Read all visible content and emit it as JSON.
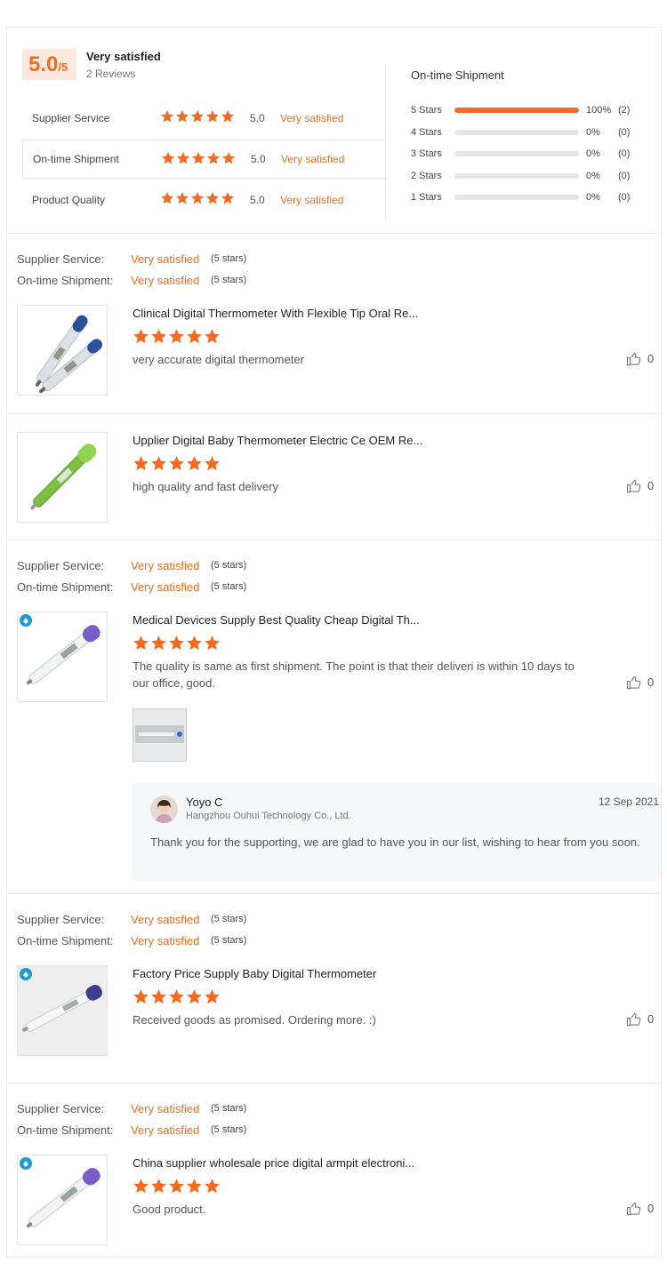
{
  "summary": {
    "score": "5.0",
    "score_unit": "/5",
    "overall_label": "Very satisfied",
    "review_count": "2 Reviews",
    "metrics": [
      {
        "name": "Supplier Service",
        "score": "5.0",
        "text": "Very satisfied"
      },
      {
        "name": "On-time Shipment",
        "score": "5.0",
        "text": "Very satisfied"
      },
      {
        "name": "Product Quality",
        "score": "5.0",
        "text": "Very satisfied"
      }
    ],
    "active_metric_index": 1,
    "distribution_title": "On-time Shipment",
    "distribution": [
      {
        "label": "5 Stars",
        "fraction": 1.0,
        "pct": "100%",
        "count": "(2)"
      },
      {
        "label": "4 Stars",
        "fraction": 0,
        "pct": "0%",
        "count": "(0)"
      },
      {
        "label": "3 Stars",
        "fraction": 0,
        "pct": "0%",
        "count": "(0)"
      },
      {
        "label": "2 Stars",
        "fraction": 0,
        "pct": "0%",
        "count": "(0)"
      },
      {
        "label": "1 Stars",
        "fraction": 0,
        "pct": "0%",
        "count": "(0)"
      }
    ]
  },
  "labels": {
    "supplier_service": "Supplier Service:",
    "ontime_shipment": "On-time Shipment:",
    "very_satisfied": "Very satisfied",
    "five_stars": "(5 stars)"
  },
  "reviews": [
    {
      "products": [
        {
          "title": "Clinical Digital Thermometer With Flexible Tip Oral Re...",
          "stars": 5,
          "text": "very accurate digital thermometer",
          "likes": "0",
          "image": "two-blue-thermometers"
        },
        {
          "title": "Upplier Digital Baby Thermometer Electric Ce OEM Re...",
          "stars": 5,
          "text": "high quality and fast delivery",
          "likes": "0",
          "image": "green-thermometer"
        }
      ]
    },
    {
      "products": [
        {
          "title": "Medical Devices Supply Best Quality Cheap Digital Th...",
          "stars": 5,
          "text": "The quality is same as first shipment. The point is that their deliveri is within 10 days to our office,  good.",
          "likes": "0",
          "image": "purple-thermometer"
        }
      ],
      "reply": {
        "name": "Yoyo C",
        "company": "Hangzhou Ouhui Technology Co., Ltd.",
        "date": "12 Sep 2021",
        "text": "Thank you for the supporting, we are glad to have you in our list, wishing to hear from you soon."
      }
    },
    {
      "products": [
        {
          "title": "Factory Price Supply Baby Digital Thermometer",
          "stars": 5,
          "text": "Received goods as promised. Ordering more. :)",
          "likes": "0",
          "image": "navy-thermometer"
        }
      ]
    },
    {
      "products": [
        {
          "title": "China supplier wholesale price digital armpit electroni...",
          "stars": 5,
          "text": "Good product.",
          "likes": "0",
          "image": "purple-thermometer"
        }
      ]
    }
  ],
  "colors": {
    "accent": "#f26b20",
    "accent_bg": "#fde8dd",
    "divider": "#e8e8e8",
    "reply_bg": "#f6f7f9"
  },
  "icons": [
    "star-icon",
    "thumbs-up-icon"
  ]
}
